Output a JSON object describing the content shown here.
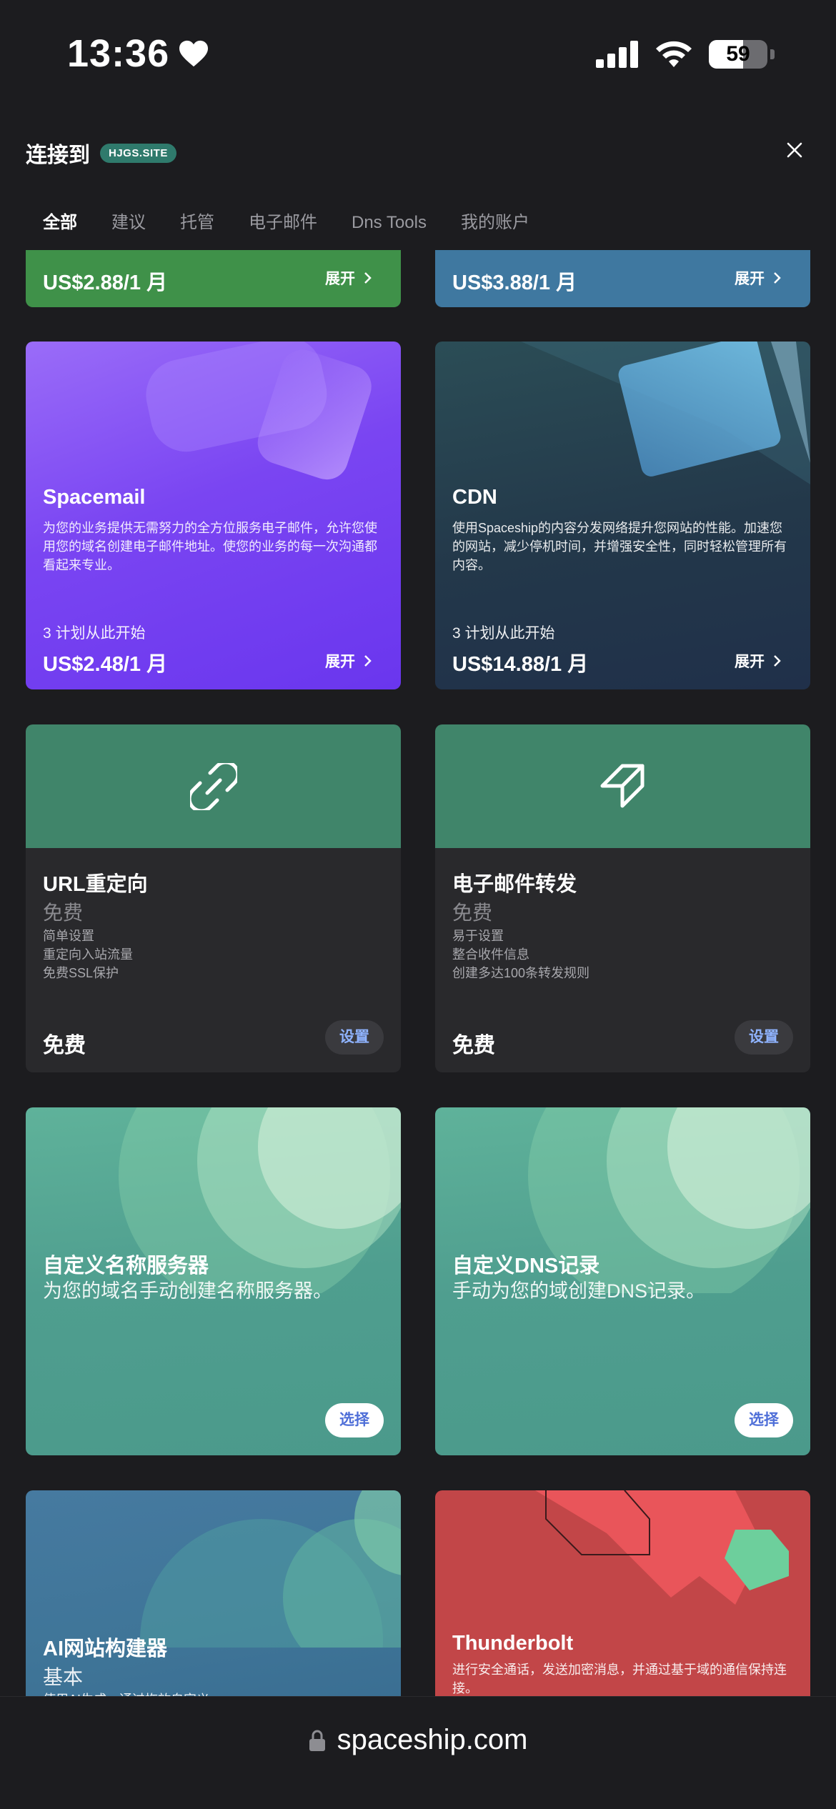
{
  "status_bar": {
    "time": "13:36",
    "battery": "59",
    "battery_level": 0.59
  },
  "header": {
    "title": "连接到",
    "domain_badge": "HJGS.SITE",
    "tabs": [
      "全部",
      "建议",
      "托管",
      "电子邮件",
      "Dns Tools",
      "我的账户"
    ],
    "active_tab": 0
  },
  "cards": {
    "top_left": {
      "price": "US$2.88/1 月",
      "expand": "展开",
      "color": "#3f9149"
    },
    "top_right": {
      "price": "US$3.88/1 月",
      "expand": "展开",
      "color": "#3f78a0"
    },
    "spacemail": {
      "title": "Spacemail",
      "desc": "为您的业务提供无需努力的全方位服务电子邮件，允许您使用您的域名创建电子邮件地址。使您的业务的每一次沟通都看起来专业。",
      "plans": "3 计划从此开始",
      "price": "US$2.48/1 月",
      "expand": "展开",
      "color": "#7a45f2"
    },
    "cdn": {
      "title": "CDN",
      "desc": "使用Spaceship的内容分发网络提升您网站的性能。加速您的网站，减少停机时间，并增强安全性，同时轻松管理所有内容。",
      "plans": "3 计划从此开始",
      "price": "US$14.88/1 月",
      "expand": "展开",
      "color": "#23384a"
    },
    "url_redirect": {
      "title": "URL重定向",
      "sub": "免费",
      "features": [
        "简单设置",
        "重定向入站流量",
        "免费SSL保护"
      ],
      "price": "免费",
      "button": "设置"
    },
    "email_forward": {
      "title": "电子邮件转发",
      "sub": "免费",
      "features": [
        "易于设置",
        "整合收件信息",
        "创建多达100条转发规则"
      ],
      "price": "免费",
      "button": "设置"
    },
    "custom_ns": {
      "title": "自定义名称服务器",
      "desc": "为您的域名手动创建名称服务器。",
      "button": "选择"
    },
    "custom_dns": {
      "title": "自定义DNS记录",
      "desc": "手动为您的域创建DNS记录。",
      "button": "选择"
    },
    "ai_builder": {
      "title": "AI网站构建器",
      "sub": "基本",
      "desc": "使用AI生成，通过拖放自定义"
    },
    "thunderbolt": {
      "title": "Thunderbolt",
      "desc": "进行安全通话，发送加密消息，并通过基于域的通信保持连接。"
    }
  },
  "url_bar": {
    "url": "spaceship.com"
  }
}
